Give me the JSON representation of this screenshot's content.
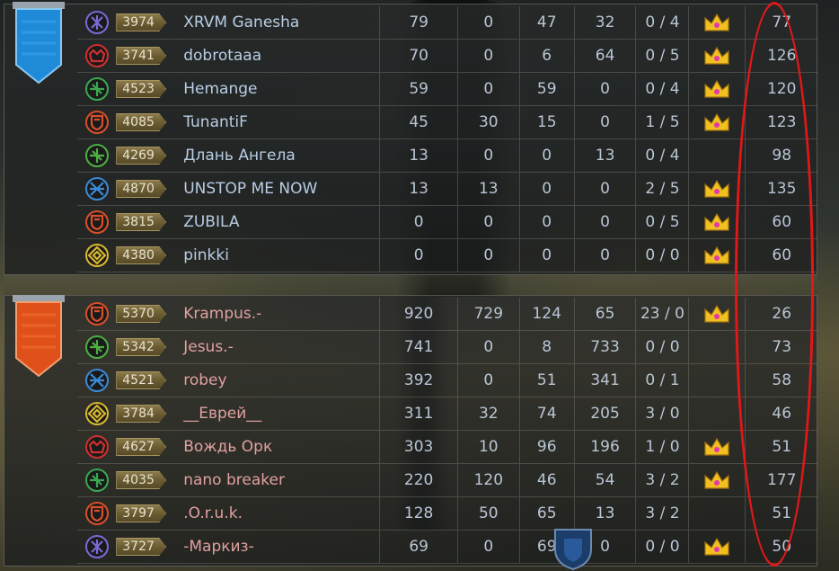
{
  "teams": [
    {
      "side": "top",
      "banner_color": "#1f8ad8",
      "players": [
        {
          "role": "order-rune-icon",
          "role_color": "#7a6ad8",
          "level": "3974",
          "name": "XRVM Ganesha",
          "s1": "79",
          "s2": "0",
          "s3": "47",
          "s4": "32",
          "ratio": "0 / 4",
          "crown": true,
          "score": "77"
        },
        {
          "role": "horned-helm-icon",
          "role_color": "#d03030",
          "level": "3741",
          "name": "dobrotaaa",
          "s1": "70",
          "s2": "0",
          "s3": "6",
          "s4": "64",
          "ratio": "0 / 5",
          "crown": true,
          "score": "126"
        },
        {
          "role": "leaf-cross-icon",
          "role_color": "#3aa850",
          "level": "4523",
          "name": "Hemange",
          "s1": "59",
          "s2": "0",
          "s3": "59",
          "s4": "0",
          "ratio": "0 / 4",
          "crown": true,
          "score": "120"
        },
        {
          "role": "flame-shield-icon",
          "role_color": "#d8502a",
          "level": "4085",
          "name": "TunantiF",
          "s1": "45",
          "s2": "30",
          "s3": "15",
          "s4": "0",
          "ratio": "1 / 5",
          "crown": true,
          "score": "123"
        },
        {
          "role": "leaf-cross-icon",
          "role_color": "#4cb040",
          "level": "4269",
          "name": "Длань Ангела",
          "s1": "13",
          "s2": "0",
          "s3": "0",
          "s4": "13",
          "ratio": "0 / 4",
          "crown": false,
          "score": "98"
        },
        {
          "role": "crossed-swords-icon",
          "role_color": "#3a8ad8",
          "level": "4870",
          "name": "UNSTOP ME NOW",
          "s1": "13",
          "s2": "13",
          "s3": "0",
          "s4": "0",
          "ratio": "2 / 5",
          "crown": true,
          "score": "135"
        },
        {
          "role": "flame-shield-icon",
          "role_color": "#d8502a",
          "level": "3815",
          "name": "ZUBILA",
          "s1": "0",
          "s2": "0",
          "s3": "0",
          "s4": "0",
          "ratio": "0 / 5",
          "crown": true,
          "score": "60"
        },
        {
          "role": "diamond-rune-icon",
          "role_color": "#d8b830",
          "level": "4380",
          "name": "pinkki",
          "s1": "0",
          "s2": "0",
          "s3": "0",
          "s4": "0",
          "ratio": "0 / 0",
          "crown": true,
          "score": "60"
        }
      ]
    },
    {
      "side": "bottom",
      "banner_color": "#e0501a",
      "players": [
        {
          "role": "flame-shield-icon",
          "role_color": "#d8502a",
          "level": "5370",
          "name": "Krampus.-",
          "s1": "920",
          "s2": "729",
          "s3": "124",
          "s4": "65",
          "ratio": "23 / 0",
          "crown": true,
          "score": "26"
        },
        {
          "role": "leaf-cross-icon",
          "role_color": "#4cb040",
          "level": "5342",
          "name": "Jesus.-",
          "s1": "741",
          "s2": "0",
          "s3": "8",
          "s4": "733",
          "ratio": "0 / 0",
          "crown": false,
          "score": "73"
        },
        {
          "role": "crossed-swords-icon",
          "role_color": "#3a8ad8",
          "level": "4521",
          "name": "robey",
          "s1": "392",
          "s2": "0",
          "s3": "51",
          "s4": "341",
          "ratio": "0 / 1",
          "crown": false,
          "score": "58"
        },
        {
          "role": "diamond-rune-icon",
          "role_color": "#d8b830",
          "level": "3784",
          "name": "__Еврей__",
          "s1": "311",
          "s2": "32",
          "s3": "74",
          "s4": "205",
          "ratio": "3 / 0",
          "crown": false,
          "score": "46"
        },
        {
          "role": "horned-helm-icon",
          "role_color": "#d03030",
          "level": "4627",
          "name": "Вождь Орк",
          "s1": "303",
          "s2": "10",
          "s3": "96",
          "s4": "196",
          "ratio": "1 / 0",
          "crown": true,
          "score": "51"
        },
        {
          "role": "leaf-cross-icon",
          "role_color": "#3aa850",
          "level": "4035",
          "name": "nano breaker",
          "s1": "220",
          "s2": "120",
          "s3": "46",
          "s4": "54",
          "ratio": "3 / 2",
          "crown": true,
          "score": "177"
        },
        {
          "role": "flame-shield-icon",
          "role_color": "#d8502a",
          "level": "3797",
          "name": ".O.r.u.k.",
          "s1": "128",
          "s2": "50",
          "s3": "65",
          "s4": "13",
          "ratio": "3 / 2",
          "crown": false,
          "score": "51"
        },
        {
          "role": "order-rune-icon",
          "role_color": "#7a6ad8",
          "level": "3727",
          "name": "-Маркиз-",
          "s1": "69",
          "s2": "0",
          "s3": "69",
          "s4": "0",
          "ratio": "0 / 0",
          "crown": true,
          "score": "50"
        }
      ]
    }
  ],
  "highlight_color": "#e01818",
  "crown_color": "#f0c020",
  "gem_color": "#e03aa8"
}
